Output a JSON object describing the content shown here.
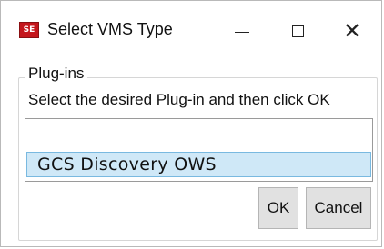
{
  "window": {
    "title": "Select VMS Type",
    "icon": "app-icon",
    "icon_text": "SE",
    "controls": [
      "minimize-icon",
      "maximize-icon",
      "close-icon"
    ],
    "close_glyph": "✕"
  },
  "group": {
    "label": "Plug-ins",
    "instruction": "Select the desired Plug-in and then click OK"
  },
  "list": {
    "items": [
      "GCS Discovery OWS"
    ],
    "selected_index": 0
  },
  "buttons": {
    "ok_label": "OK",
    "cancel_label": "Cancel"
  },
  "colors": {
    "selection_bg": "#cfe8f7",
    "selection_border": "#79b9e0",
    "icon_red": "#c4161c"
  }
}
